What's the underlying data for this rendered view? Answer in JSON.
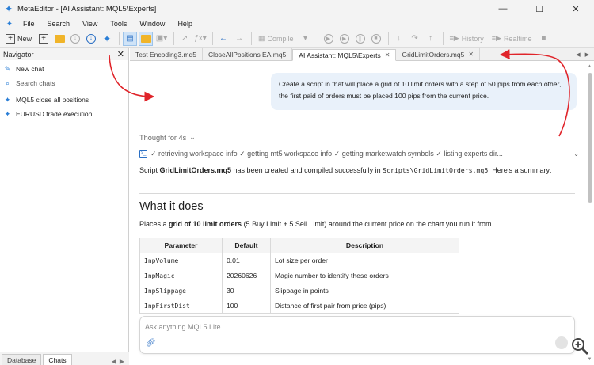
{
  "window": {
    "title": "MetaEditor - [AI Assistant: MQL5\\Experts]",
    "controls": [
      "—",
      "☐",
      "✕"
    ]
  },
  "menu": [
    "File",
    "Search",
    "View",
    "Tools",
    "Window",
    "Help"
  ],
  "toolbar": {
    "new_label": "New",
    "compile_label": "Compile",
    "history_label": "History",
    "realtime_label": "Realtime"
  },
  "navigator": {
    "title": "Navigator",
    "new_chat": "New chat",
    "search_chats": "Search chats",
    "chats": [
      "MQL5 close all positions",
      "EURUSD trade execution"
    ],
    "tabs": [
      "Database",
      "Chats"
    ]
  },
  "tabs": [
    {
      "label": "Test Encoding3.mq5",
      "selected": false
    },
    {
      "label": "CloseAllPositions EA.mq5",
      "selected": false
    },
    {
      "label": "AI Assistant: MQL5\\Experts",
      "selected": true
    },
    {
      "label": "GridLimitOrders.mq5",
      "selected": false
    }
  ],
  "chat": {
    "user_message": "Create a script in that will place a grid of 10 limit orders with a step of 50 pips from each other, the first paid of orders must be placed 100 pips from the current price.",
    "thought": "Thought for 4s",
    "steps": "✓ retrieving workspace info ✓ getting mt5 workspace info ✓ getting marketwatch symbols ✓ listing experts dir...",
    "summary": {
      "prefix": "Script ",
      "file": "GridLimitOrders.mq5",
      "middle": " has been created and compiled successfully in ",
      "path": "Scripts\\GridLimitOrders.mq5",
      "suffix": ". Here's a summary:"
    },
    "heading": "What it does",
    "places": {
      "prefix": "Places a ",
      "bold": "grid of 10 limit orders",
      "suffix": " (5 Buy Limit + 5 Sell Limit) around the current price on the chart you run it from."
    },
    "table": {
      "headers": [
        "Parameter",
        "Default",
        "Description"
      ],
      "rows": [
        [
          "InpVolume",
          "0.01",
          "Lot size per order"
        ],
        [
          "InpMagic",
          "20260626",
          "Magic number to identify these orders"
        ],
        [
          "InpSlippage",
          "30",
          "Slippage in points"
        ],
        [
          "InpFirstDist",
          "100",
          "Distance of first pair from price (pips)"
        ]
      ]
    },
    "input_placeholder": "Ask anything MQL5 Lite"
  },
  "colors": {
    "accent": "#2a7ed6",
    "bubble": "#e9f1fa",
    "arrow": "#e0242a"
  }
}
